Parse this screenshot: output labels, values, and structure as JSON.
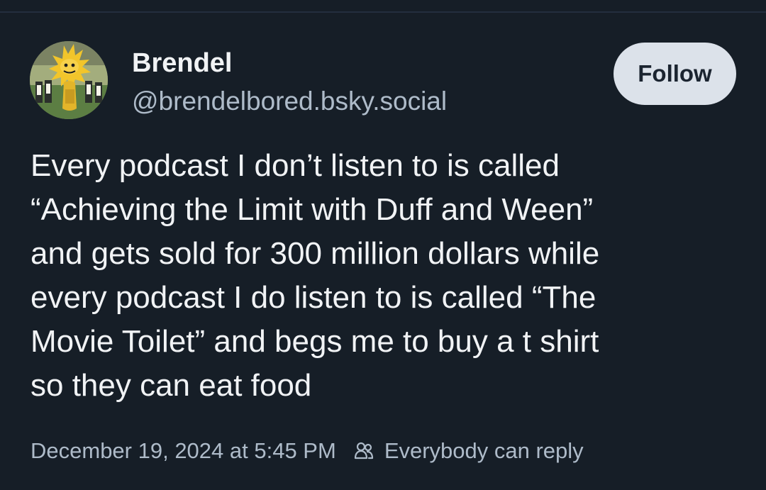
{
  "post": {
    "author": {
      "display_name": "Brendel",
      "handle": "@brendelbored.bsky.social"
    },
    "follow_label": "Follow",
    "text_lines": [
      "Every podcast I don’t listen to is called",
      "“Achieving the Limit with Duff and Ween”",
      "and gets sold for 300 million dollars while",
      "every podcast I do listen to is called “The",
      "Movie Toilet” and begs me to buy a t shirt",
      "so they can eat food"
    ],
    "timestamp": "December 19, 2024 at 5:45 PM",
    "reply_setting": "Everybody can reply",
    "reply_icon": "people-icon",
    "avatar_icon": "avatar-image"
  },
  "colors": {
    "background": "#161e27",
    "text": "#f1f3f5",
    "secondary_text": "#aebbc9",
    "follow_button": "#dce2ea"
  }
}
